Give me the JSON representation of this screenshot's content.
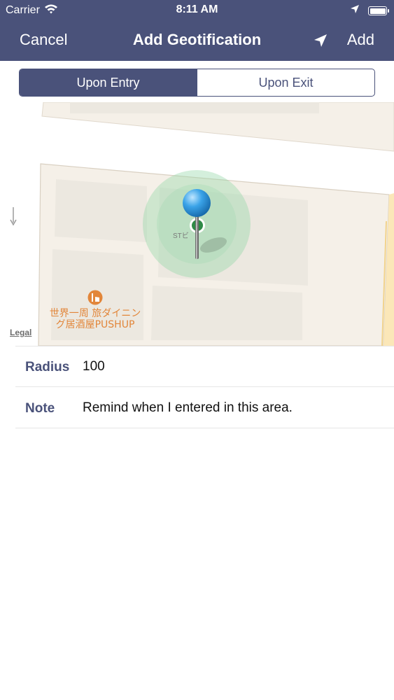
{
  "status_bar": {
    "carrier": "Carrier",
    "time": "8:11 AM",
    "battery_level": 1.0,
    "icons": [
      "wifi-icon",
      "location-arrow-icon",
      "battery-icon"
    ]
  },
  "nav": {
    "cancel_label": "Cancel",
    "title": "Add Geotification",
    "add_label": "Add",
    "location_icon": "location-arrow-icon"
  },
  "segmented": {
    "options": [
      "Upon Entry",
      "Upon Exit"
    ],
    "selected_index": 0
  },
  "map": {
    "building_label": "STビ",
    "poi_name_line1": "世界一周 旅ダイニン",
    "poi_name_line2": "グ居酒屋PUSHUP",
    "poi_icon": "restaurant-icon",
    "pin_icon": "map-pin-icon",
    "legal_label": "Legal"
  },
  "form": {
    "radius_label": "Radius",
    "radius_value": "100",
    "note_label": "Note",
    "note_value": "Remind when I entered in this area."
  },
  "colors": {
    "nav_background": "#4a527a",
    "accent": "#4a527a",
    "poi_orange": "#e2863a",
    "map_block": "#f5f0e8",
    "map_building": "#ece8e0",
    "radius_overlay": "#8fd6a4",
    "pin_blue": "#3aa3e8",
    "caret": "#7fcac0"
  }
}
